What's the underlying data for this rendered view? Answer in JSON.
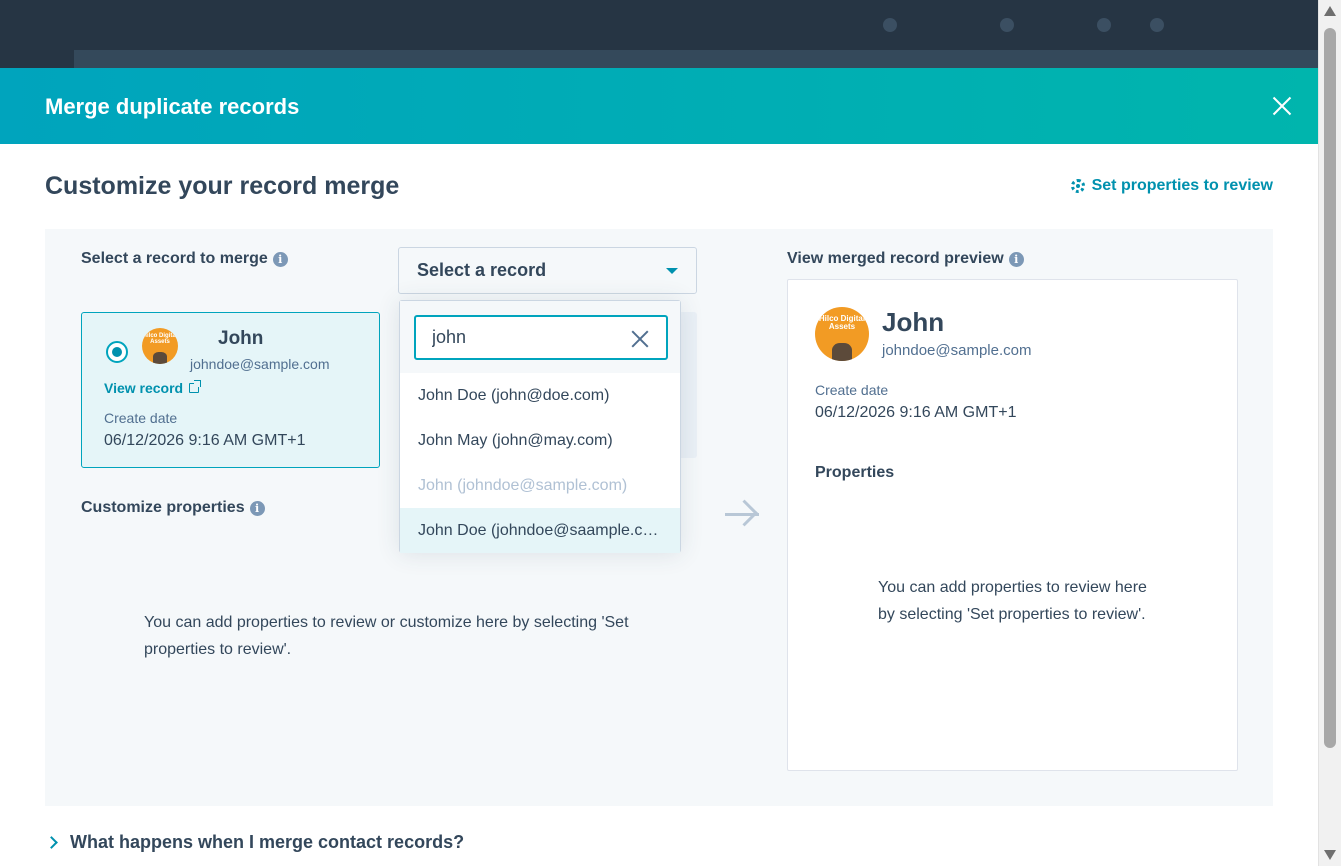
{
  "modal": {
    "title": "Merge duplicate records",
    "section_title": "Customize your record merge",
    "set_properties_link": "Set properties to review"
  },
  "select_record": {
    "label": "Select a record to merge",
    "dropdown_value": "Select a record",
    "search_value": "john",
    "options": [
      {
        "label": "John Doe (john@doe.com)",
        "disabled": false
      },
      {
        "label": "John May (john@may.com)",
        "disabled": false
      },
      {
        "label": "John (johndoe@sample.com)",
        "disabled": true
      },
      {
        "label": "John Doe (johndoe@saample.com)",
        "disabled": false,
        "highlighted": true
      }
    ]
  },
  "record_card": {
    "name": "John",
    "email": "johndoe@sample.com",
    "view_record": "View record",
    "create_date_label": "Create date",
    "create_date": "06/12/2026 9:16 AM GMT+1",
    "avatar_text": "Hilco Digital Assets"
  },
  "customize": {
    "label": "Customize properties",
    "hint": "You can add properties to review or customize here by selecting 'Set properties to review'."
  },
  "preview": {
    "label": "View merged record preview",
    "name": "John",
    "email": "johndoe@sample.com",
    "create_date_label": "Create date",
    "create_date": "06/12/2026 9:16 AM GMT+1",
    "properties_heading": "Properties",
    "hint": "You can add properties to review here by selecting 'Set properties to review'."
  },
  "accordion": {
    "label": "What happens when I merge contact records?"
  },
  "colors": {
    "header_gradient_start": "#00a4bd",
    "header_gradient_end": "#00b5ad",
    "accent": "#0091ae",
    "text": "#33475b"
  }
}
